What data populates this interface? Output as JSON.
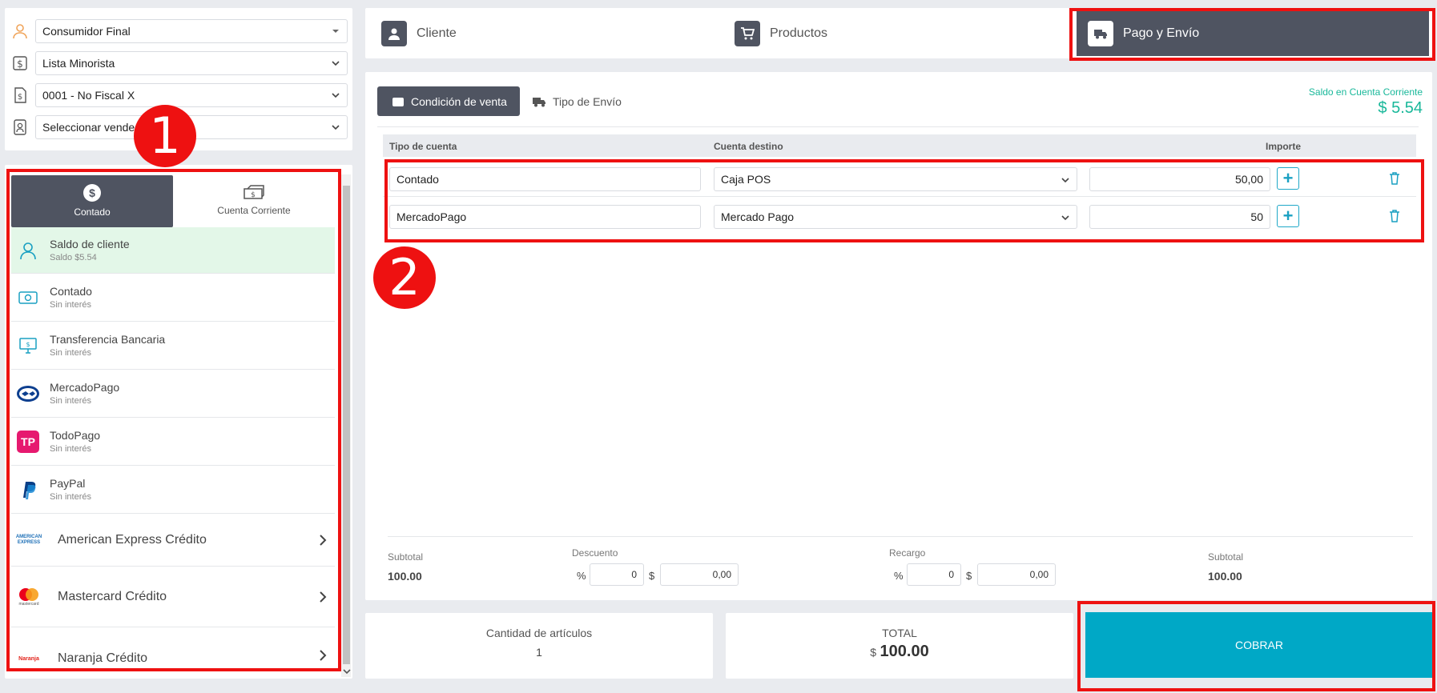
{
  "customer_selects": {
    "customer": "Consumidor Final",
    "price_list": "Lista Minorista",
    "point_of_sale": "0001 - No Fiscal X",
    "seller": "Seleccionar vendedor"
  },
  "pay_tabs": {
    "cash": "Contado",
    "account": "Cuenta Corriente"
  },
  "payment_methods": [
    {
      "name": "Saldo de cliente",
      "sub": "Saldo $5.54"
    },
    {
      "name": "Contado",
      "sub": "Sin interés"
    },
    {
      "name": "Transferencia Bancaria",
      "sub": "Sin interés"
    },
    {
      "name": "MercadoPago",
      "sub": "Sin interés"
    },
    {
      "name": "TodoPago",
      "sub": "Sin interés"
    },
    {
      "name": "PayPal",
      "sub": "Sin interés"
    }
  ],
  "card_methods": [
    {
      "name": "American Express Crédito",
      "logo": "AMERICAN EXPRESS"
    },
    {
      "name": "Mastercard Crédito",
      "logo": "mastercard"
    },
    {
      "name": "Naranja Crédito",
      "logo": "Naranja"
    }
  ],
  "todopago_logo": "TP",
  "top_tabs": {
    "client": "Cliente",
    "products": "Productos",
    "payment": "Pago y Envío"
  },
  "sub_tabs": {
    "sale_condition": "Condición de venta",
    "shipping": "Tipo de Envío"
  },
  "balance": {
    "label": "Saldo en Cuenta Corriente",
    "value": "$ 5.54"
  },
  "table": {
    "headers": {
      "account_type": "Tipo de cuenta",
      "destination": "Cuenta destino",
      "amount": "Importe"
    },
    "rows": [
      {
        "account_type": "Contado",
        "destination": "Caja POS",
        "amount": "50,00"
      },
      {
        "account_type": "MercadoPago",
        "destination": "Mercado Pago",
        "amount": "50"
      }
    ]
  },
  "totals": {
    "subtotal_label": "Subtotal",
    "subtotal": "100.00",
    "discount_label": "Descuento",
    "discount_pct": "0",
    "discount_amt": "0,00",
    "surcharge_label": "Recargo",
    "surcharge_pct": "0",
    "surcharge_amt": "0,00",
    "subtotal2_label": "Subtotal",
    "subtotal2": "100.00",
    "pct_symbol": "%",
    "currency_symbol": "$"
  },
  "summary": {
    "items_label": "Cantidad de artículos",
    "items_count": "1",
    "total_label": "TOTAL",
    "currency": "$",
    "total": "100.00",
    "charge_button": "COBRAR"
  },
  "annotations": {
    "one": "1",
    "two": "2"
  },
  "colors": {
    "accent": "#00a8c6",
    "dark": "#4f5461",
    "green": "#19b89a",
    "highlight": "#e3f7e8",
    "annotation": "#ee1111"
  }
}
